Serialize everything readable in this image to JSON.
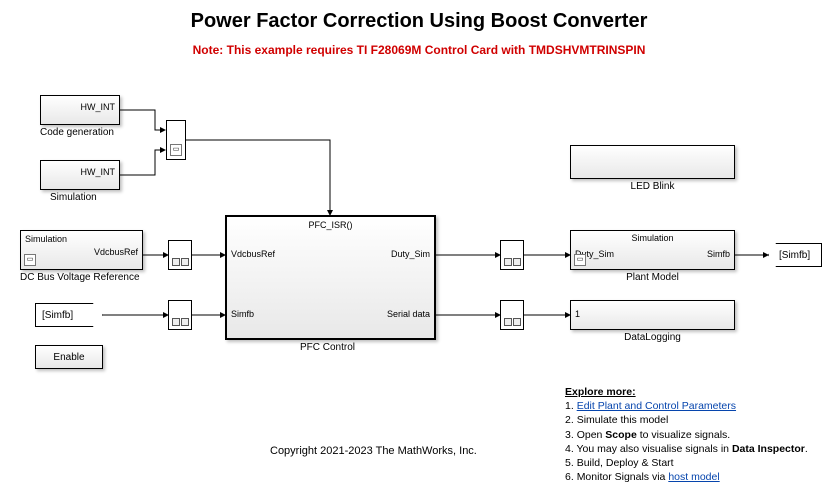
{
  "title": "Power Factor Correction Using Boost Converter",
  "note": "Note: This example requires TI F28069M Control Card with TMDSHVMTRINSPIN",
  "blocks": {
    "hwint1": {
      "label": "HW_INT",
      "caption": "Code generation"
    },
    "hwint2": {
      "label": "HW_INT",
      "caption": "Simulation"
    },
    "dcref": {
      "tag": "Simulation",
      "port": "VdcbusRef",
      "caption": "DC Bus Voltage Reference"
    },
    "simfb_in": {
      "label": "[Simfb]"
    },
    "enable": {
      "label": "Enable"
    },
    "pfc": {
      "fn": "PFC_ISR()",
      "in1": "VdcbusRef",
      "in2": "Simfb",
      "out1": "Duty_Sim",
      "out2": "Serial data",
      "caption": "PFC Control"
    },
    "led": {
      "caption": "LED Blink"
    },
    "plant": {
      "tag": "Simulation",
      "in": "Duty_Sim",
      "out": "Simfb",
      "caption": "Plant Model"
    },
    "datalog": {
      "in": "1",
      "caption": "DataLogging"
    },
    "simfb_out": {
      "label": "[Simfb]"
    }
  },
  "explore": {
    "header": "Explore more:",
    "items": [
      {
        "n": "1.",
        "prefix": "",
        "link": "Edit Plant and Control Parameters",
        "suffix": ""
      },
      {
        "n": "2.",
        "prefix": "Simulate this model",
        "link": "",
        "suffix": ""
      },
      {
        "n": "3.",
        "prefix": "Open ",
        "bold": "Scope",
        "suffix": " to visualize signals."
      },
      {
        "n": "4.",
        "prefix": "You may also visualise signals in ",
        "bold": "Data Inspector",
        "suffix": "."
      },
      {
        "n": "5.",
        "prefix": "Build, Deploy & Start",
        "link": "",
        "suffix": ""
      },
      {
        "n": "6.",
        "prefix": "Monitor Signals via ",
        "link": "host model",
        "suffix": ""
      }
    ]
  },
  "copyright": "Copyright 2021-2023 The MathWorks, Inc."
}
